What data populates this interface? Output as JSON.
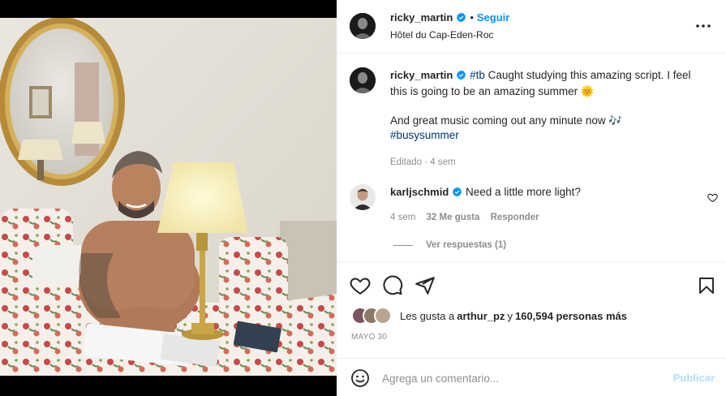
{
  "post": {
    "username": "ricky_martin",
    "follow_label": "Seguir",
    "separator": "•",
    "location": "Hôtel du Cap-Eden-Roc",
    "caption_username": "ricky_martin",
    "caption_tag": "#tb",
    "caption_line1": " Caught studying this amazing script. I feel this is going to be an amazing summer",
    "caption_emoji1": "🌞",
    "caption_line2": "And great music coming out any minute now",
    "caption_emoji2": "🎶",
    "caption_hashtag": "#busysummer",
    "caption_meta": "Editado · 4 sem"
  },
  "comment": {
    "username": "karljschmid",
    "text": "Need a little more light?",
    "age": "4 sem",
    "likes": "32 Me gusta",
    "reply": "Responder",
    "view_replies": "Ver respuestas (1)"
  },
  "likes": {
    "prefix": "Les gusta a ",
    "user": "arthur_pz",
    "middle": " y ",
    "count": "160,594 personas más"
  },
  "date": "MAYO 30",
  "add_comment": {
    "placeholder": "Agrega un comentario...",
    "publish": "Publicar"
  },
  "icons": {
    "verified": "verified-badge-icon",
    "more": "more-options-icon",
    "like": "heart-icon",
    "comment": "comment-icon",
    "share": "paper-plane-icon",
    "save": "bookmark-icon",
    "emoji": "smiley-icon"
  },
  "colors": {
    "link": "#0095f6",
    "hashtag": "#00376b",
    "muted": "#8e8e8e",
    "publish_disabled": "#b2dffc"
  }
}
